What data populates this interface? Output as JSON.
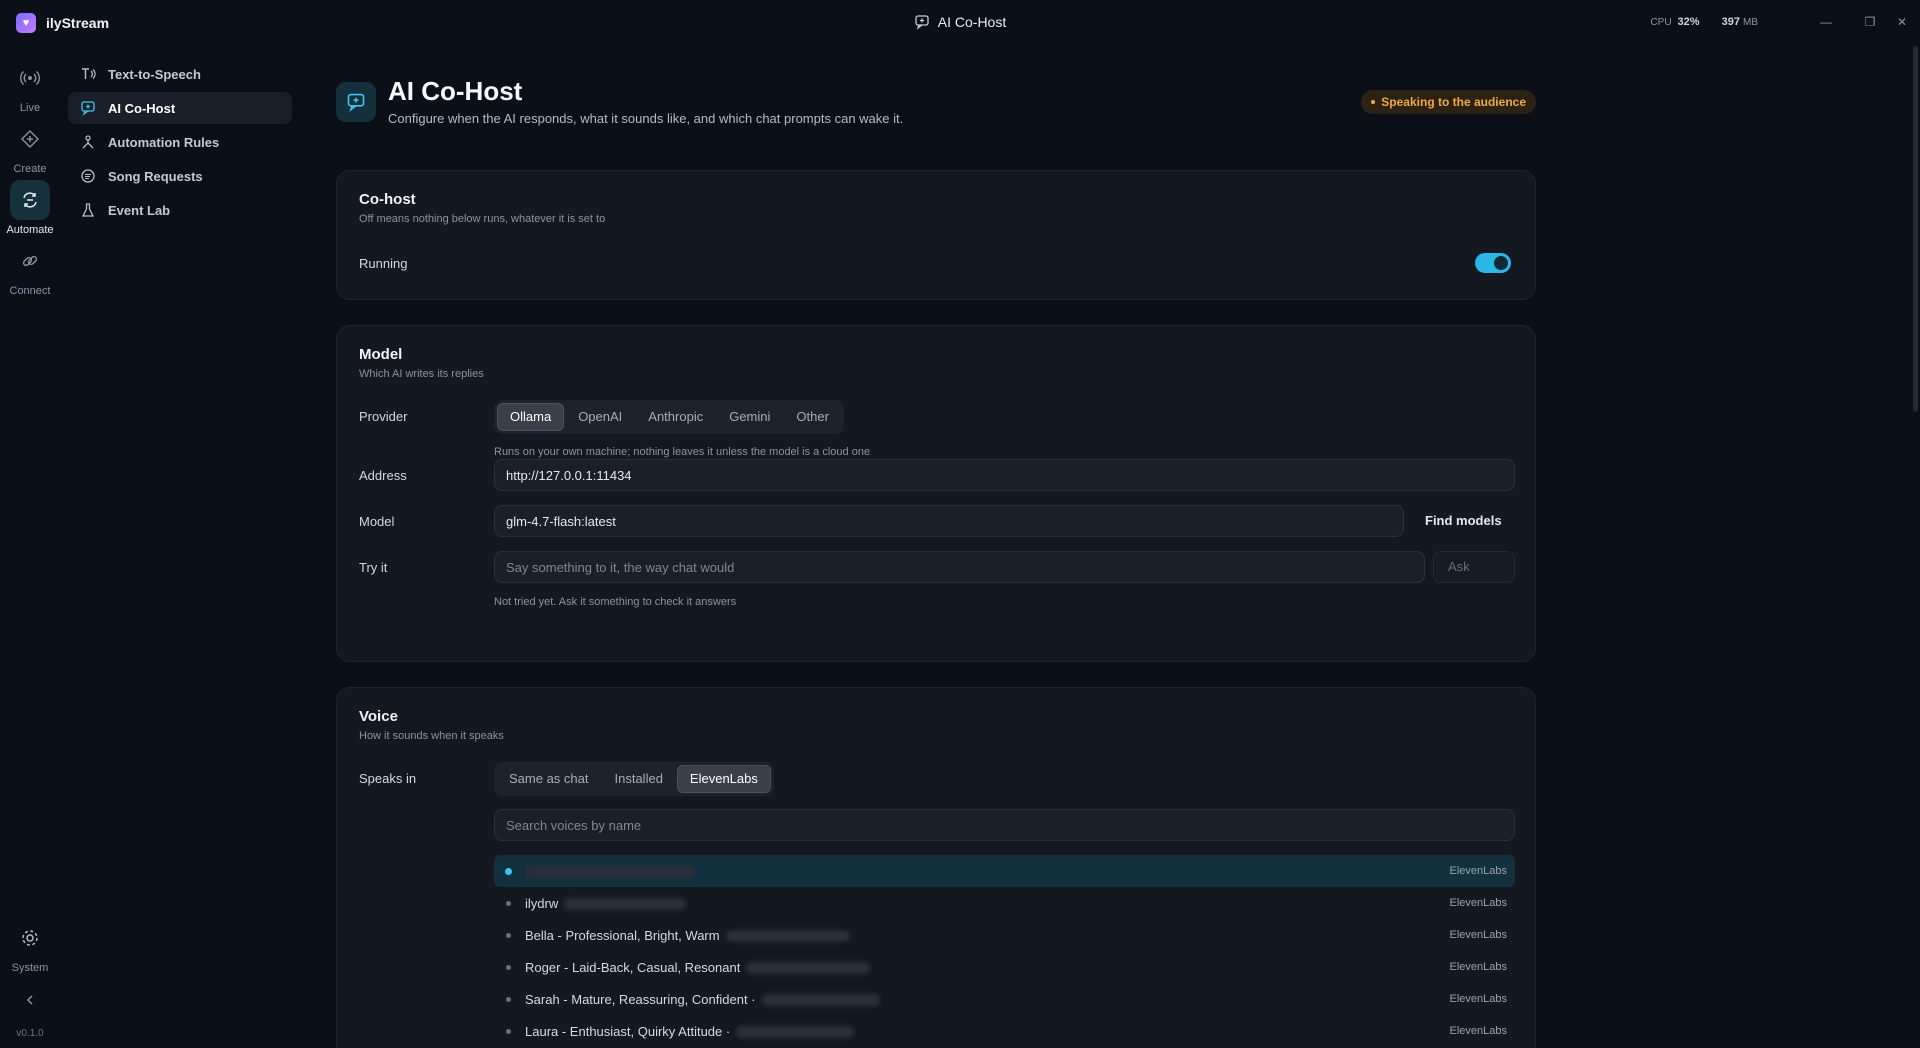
{
  "app": {
    "name": "ilyStream",
    "window_title": "AI Co-Host"
  },
  "stats": {
    "cpu_label": "CPU",
    "cpu_value": "32%",
    "mem_value": "397",
    "mem_unit": "MB"
  },
  "rail": {
    "items": [
      {
        "label": "Live",
        "icon": "broadcast-icon"
      },
      {
        "label": "Create",
        "icon": "create-icon"
      },
      {
        "label": "Automate",
        "icon": "automate-icon"
      },
      {
        "label": "Connect",
        "icon": "link-icon"
      }
    ],
    "system_label": "System",
    "version": "v0.1.0"
  },
  "subnav": {
    "items": [
      {
        "label": "Text-to-Speech"
      },
      {
        "label": "AI Co-Host"
      },
      {
        "label": "Automation Rules"
      },
      {
        "label": "Song Requests"
      },
      {
        "label": "Event Lab"
      }
    ]
  },
  "page": {
    "title": "AI Co-Host",
    "subtitle": "Configure when the AI responds, what it sounds like, and which chat prompts can wake it.",
    "status": "Speaking to the audience"
  },
  "cohost": {
    "title": "Co-host",
    "subtitle": "Off means nothing below runs, whatever it is set to",
    "running_label": "Running",
    "running": true
  },
  "model": {
    "title": "Model",
    "subtitle": "Which AI writes its replies",
    "provider_label": "Provider",
    "providers": [
      "Ollama",
      "OpenAI",
      "Anthropic",
      "Gemini",
      "Other"
    ],
    "provider_selected": "Ollama",
    "provider_hint": "Runs on your own machine; nothing leaves it unless the model is a cloud one",
    "address_label": "Address",
    "address_value": "http://127.0.0.1:11434",
    "model_label": "Model",
    "model_value": "glm-4.7-flash:latest",
    "find_models": "Find models",
    "try_label": "Try it",
    "try_placeholder": "Say something to it, the way chat would",
    "ask_button": "Ask",
    "try_hint": "Not tried yet. Ask it something to check it answers"
  },
  "voice": {
    "title": "Voice",
    "subtitle": "How it sounds when it speaks",
    "speaks_in_label": "Speaks in",
    "options": [
      "Same as chat",
      "Installed",
      "ElevenLabs"
    ],
    "selected": "ElevenLabs",
    "search_placeholder": "Search voices by name",
    "voices": [
      {
        "name": "",
        "source": "ElevenLabs"
      },
      {
        "name": "ilydrw",
        "source": "ElevenLabs"
      },
      {
        "name": "Bella - Professional, Bright, Warm",
        "source": "ElevenLabs"
      },
      {
        "name": "Roger - Laid-Back, Casual, Resonant",
        "source": "ElevenLabs"
      },
      {
        "name": "Sarah - Mature, Reassuring, Confident ·",
        "source": "ElevenLabs"
      },
      {
        "name": "Laura - Enthusiast, Quirky Attitude ·",
        "source": "ElevenLabs"
      }
    ]
  },
  "colors": {
    "accent": "#29b7e5",
    "status": "#f0a845",
    "bg": "#0b0f17",
    "card": "#141820"
  }
}
